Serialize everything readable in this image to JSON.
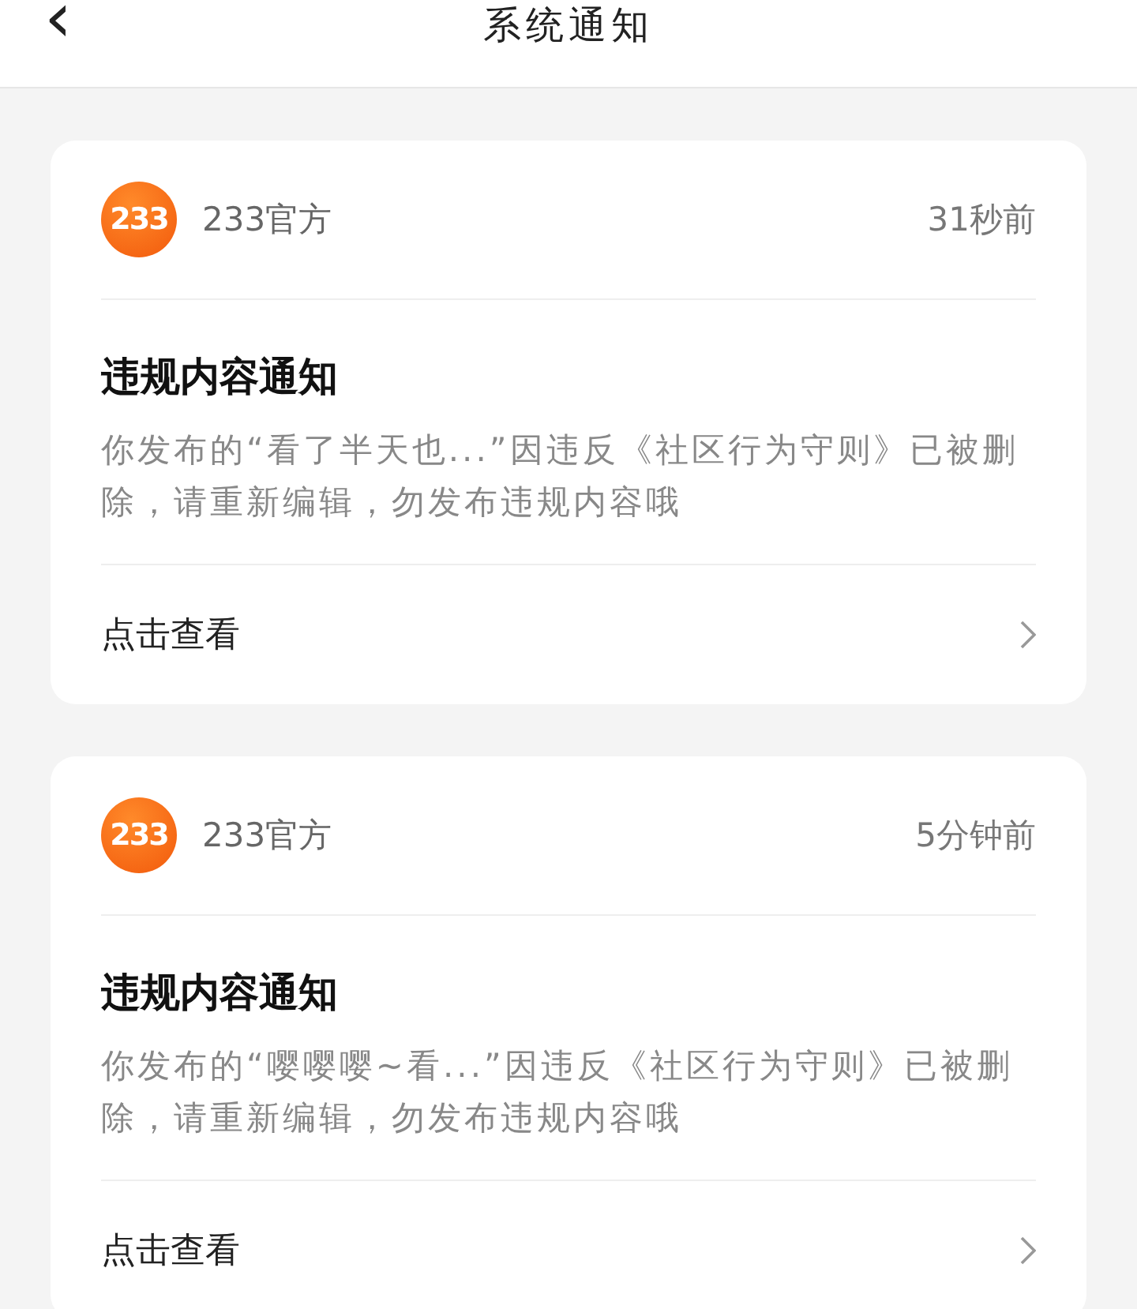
{
  "header": {
    "back_icon": "‹",
    "title": "系统通知"
  },
  "notifications": [
    {
      "logo_text": "233",
      "sender": "233官方",
      "time": "31秒前",
      "title": "违规内容通知",
      "body": "你发布的“看了半天也...”因违反《社区行为守则》已被删除，请重新编辑，勿发布违规内容哦",
      "action": "点击查看"
    },
    {
      "logo_text": "233",
      "sender": "233官方",
      "time": "5分钟前",
      "title": "违规内容通知",
      "body": "你发布的“嘤嘤嘤~看...”因违反《社区行为守则》已被删除，请重新编辑，勿发布违规内容哦",
      "action": "点击查看"
    }
  ]
}
